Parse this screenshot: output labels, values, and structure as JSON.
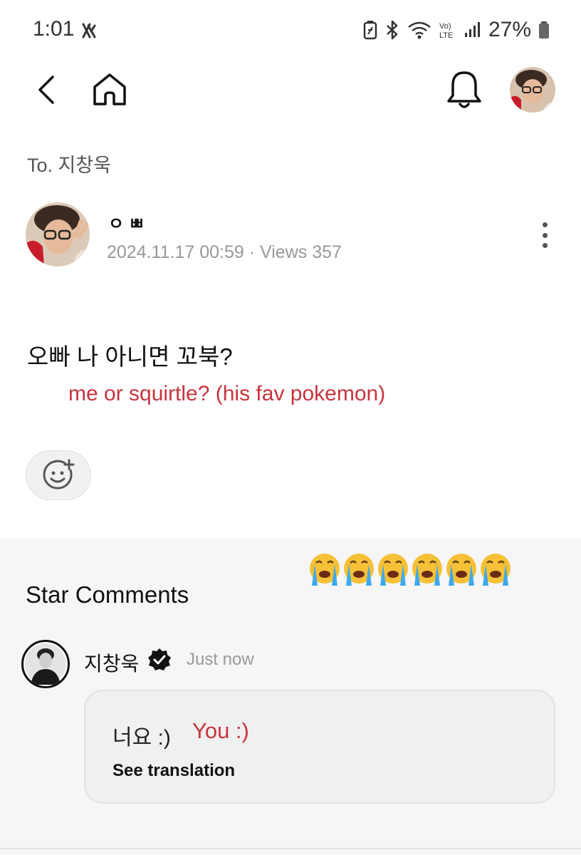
{
  "status_bar": {
    "time": "1:01",
    "battery": "27%"
  },
  "header": {
    "back_icon": "chevron-left-icon",
    "home_icon": "home-icon",
    "bell_icon": "bell-icon"
  },
  "post": {
    "to": "To. 지창욱",
    "author_name": "ㅇ ㅃ",
    "date": "2024.11.17 00:59",
    "separator": "·",
    "views": "Views 357",
    "body": "오빠 나 아니면 꼬북?",
    "annotation": "me or squirtle? (his fav pokemon)"
  },
  "comments": {
    "title": "Star Comments",
    "emoji_count": 6,
    "items": [
      {
        "name": "지창욱",
        "time": "Just now",
        "text": "너요 :)",
        "annotation": "You :)",
        "translate_label": "See translation"
      }
    ]
  },
  "colors": {
    "annotation_red": "#c8343e",
    "meta_gray": "#999999",
    "section_bg": "#f6f6f6"
  }
}
